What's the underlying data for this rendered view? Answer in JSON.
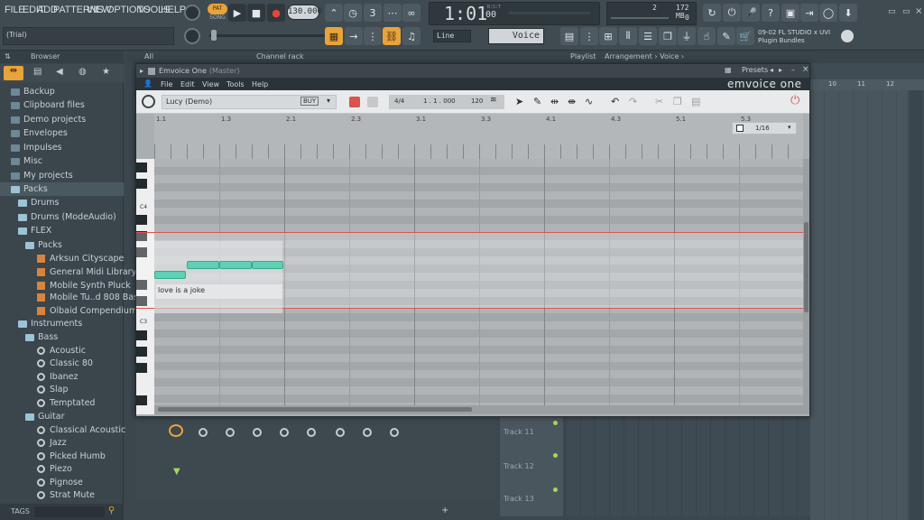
{
  "menu": [
    "FILE",
    "EDIT",
    "ADD",
    "PATTERNS",
    "VIEW",
    "OPTIONS",
    "TOOLS",
    "HELP"
  ],
  "transport": {
    "pat_label": "PAT",
    "song_label": "SONG",
    "tempo": "130.000",
    "time": "1:01",
    "time_sub": ":00",
    "time_mode": "B:S:T",
    "memory": "172 MB",
    "cpu_count": "2",
    "cpu_zero": "0"
  },
  "hint_line": "09-02  FL STUDIO x UVI",
  "hint_line2": "Plugin Bundles",
  "title_trial": "(Trial)",
  "snap_label": "Line",
  "voice_label": "Voice",
  "browser": {
    "label": "Browser",
    "items": [
      {
        "label": "Backup"
      },
      {
        "label": "Clipboard files"
      },
      {
        "label": "Demo projects"
      },
      {
        "label": "Envelopes"
      },
      {
        "label": "Impulses"
      },
      {
        "label": "Misc"
      },
      {
        "label": "My projects"
      },
      {
        "label": "Packs"
      },
      {
        "label": "Drums"
      },
      {
        "label": "Drums (ModeAudio)"
      },
      {
        "label": "FLEX"
      },
      {
        "label": "Packs"
      },
      {
        "label": "Arksun Cityscape"
      },
      {
        "label": "General Midi Library"
      },
      {
        "label": "Mobile Synth Pluck"
      },
      {
        "label": "Mobile Tu..d 808 Bass"
      },
      {
        "label": "Olbaid Compendium"
      },
      {
        "label": "Instruments"
      },
      {
        "label": "Bass"
      },
      {
        "label": "Acoustic"
      },
      {
        "label": "Classic 80"
      },
      {
        "label": "Ibanez"
      },
      {
        "label": "Slap"
      },
      {
        "label": "Temptated"
      },
      {
        "label": "Guitar"
      },
      {
        "label": "Classical Acoustic"
      },
      {
        "label": "Jazz"
      },
      {
        "label": "Picked Humb"
      },
      {
        "label": "Piezo"
      },
      {
        "label": "Pignose"
      },
      {
        "label": "Strat Mute"
      }
    ],
    "tags_label": "TAGS"
  },
  "channel_rack": {
    "filter": "All",
    "label": "Channel rack"
  },
  "playlist": {
    "label": "Playlist",
    "crumb": "Arrangement › Voice ›",
    "tracks": [
      "Track 11",
      "Track 12",
      "Track 13"
    ],
    "bars": [
      "10",
      "11",
      "12"
    ]
  },
  "plugin": {
    "title": "Emvoice One",
    "title_sub": "(Master)",
    "presets_label": "Presets",
    "menu": [
      "File",
      "Edit",
      "View",
      "Tools",
      "Help"
    ],
    "brand": "emvoice one",
    "preset": "Lucy (Demo)",
    "buy": "BUY",
    "time_sig": "4/4",
    "position": "1 . 1 . 000",
    "tempo": "120",
    "grid": "1/16",
    "ruler": [
      "1.1",
      "1.3",
      "2.1",
      "2.3",
      "3.1",
      "3.3",
      "4.1",
      "4.3",
      "5.1",
      "5.3"
    ],
    "key_c4": "C4",
    "key_c3": "C3",
    "lyric": "love is a joke"
  }
}
